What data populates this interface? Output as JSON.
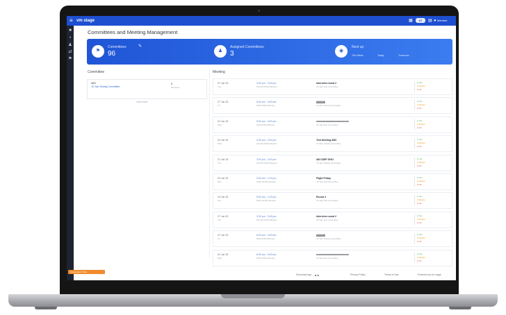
{
  "topbar": {
    "brand": "vm stage",
    "badge": "AT",
    "user": "Member"
  },
  "page": {
    "title": "Committees and Meeting Management"
  },
  "hero": {
    "committees": {
      "label": "Committees",
      "value": "96"
    },
    "assigned": {
      "label": "Assigned Committees",
      "value": "3"
    },
    "next": {
      "label": "Next up",
      "items": [
        "This Week",
        "Today",
        "Tomorrow"
      ]
    }
  },
  "left": {
    "title": "Committee",
    "card": {
      "name": "ABC",
      "sub": "JC San Testing Committee",
      "count": "0",
      "count_label": "Members"
    },
    "view_more": "View more"
  },
  "right": {
    "title": "Meeting"
  },
  "meetings": [
    {
      "date": "27 Jun 23",
      "day": "Tue",
      "time": "3:30 pm - 3:45 pm",
      "room": "(15:30-15:45) Minutes",
      "title": "Interview round 2",
      "committee": "JC San Test Committee",
      "status": [
        "Yes",
        "Maybe",
        "No"
      ]
    },
    {
      "date": "27 Jun 23",
      "day": "Fri",
      "time": "8:00 am - 9:00 am",
      "room": "(8:00-9:00) Minutes",
      "title": "jjjjjjjjjjjjj",
      "committee": "JC San Testing Committee",
      "status": [
        "Yes",
        "Maybe",
        "No"
      ]
    },
    {
      "date": "22 Jun 23",
      "day": "Wed",
      "time": "8:00 am - 9:00 am",
      "room": "(8:00-9:00) Minutes",
      "title": "xxxxxxxxxxxxxxxxxxxxxxxx",
      "committee": "JC San Test Committee",
      "status": [
        "Yes",
        "Maybe",
        "No"
      ]
    },
    {
      "date": "22 Jun 23",
      "day": "Wed",
      "time": "2:00 pm - 4:00 pm",
      "room": "(14:00-16:00) Minutes",
      "title": "Test Meeting ABC",
      "committee": "JC San Testing Committee",
      "status": [
        "Yes",
        "Maybe",
        "No"
      ]
    },
    {
      "date": "21 Jun 23",
      "day": "Tue",
      "time": "3:00 pm - 4:00 pm",
      "room": "(15:00-16:00) Minutes",
      "title": "AB CDEF GHIJ",
      "committee": "JC San Testing Committee",
      "status": [
        "Yes",
        "Maybe",
        "No"
      ]
    },
    {
      "date": "20 Jun 23",
      "day": "Mon",
      "time": "9:00 am - 1:00 pm",
      "room": "(9:00-13:00) Minutes",
      "title": "Flight Friday",
      "committee": "JC San Test Committee",
      "status": [
        "Yes",
        "Maybe",
        "No"
      ]
    },
    {
      "date": "19 Jun 23",
      "day": "Sun",
      "time": "8:00 am - 1:00 pm",
      "room": "(8:00-13:00) Minutes",
      "title": "Round 4",
      "committee": "JC San Test Committee",
      "status": [
        "Yes",
        "Maybe",
        "No"
      ]
    },
    {
      "date": "27 Jun 23",
      "day": "Tue",
      "time": "3:30 pm - 3:45 pm",
      "room": "(15:30-15:45) Minutes",
      "title": "Interview round 2",
      "committee": "JC San Test Committee",
      "status": [
        "Yes",
        "Maybe",
        "No"
      ]
    },
    {
      "date": "27 Jun 23",
      "day": "Fri",
      "time": "8:00 am - 9:00 am",
      "room": "(8:00-9:00) Minutes",
      "title": "jjjjjjjjjjjjj",
      "committee": "JC San Testing Committee",
      "status": [
        "Yes",
        "Maybe",
        "No"
      ]
    },
    {
      "date": "22 Jun 23",
      "day": "Wed",
      "time": "8:00 am - 9:00 am",
      "room": "(8:00-9:00) Minutes",
      "title": "xxxxxxxxxxxxxxxxxxxxxxxx",
      "committee": "JC San Test Committee",
      "status": [
        "Yes",
        "Maybe",
        "No"
      ]
    }
  ],
  "footer": {
    "download": "Download app",
    "privacy": "Privacy Policy",
    "terms": "Terms of Use",
    "powered": "Powered by vm stage"
  },
  "sidebar_alert": "Incomplete Profile",
  "icons": {
    "menu": "hamburger-icon",
    "committees": "flag-icon",
    "assigned": "person-icon",
    "next": "eye-icon"
  },
  "colors": {
    "brand": "#1e4fd0",
    "hero": "#2f66e0",
    "yes": "#4caf50",
    "maybe": "#f39c12",
    "no": "#e74c3c"
  }
}
